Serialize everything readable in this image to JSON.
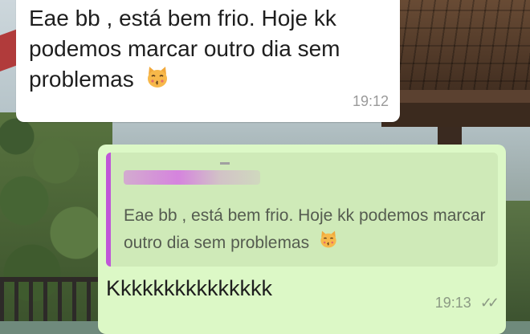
{
  "incoming_message": {
    "text": "Eae bb , está bem frio. Hoje kk podemos marcar outro dia sem problemas",
    "emoji": "cat-kissing-face",
    "time": "19:12"
  },
  "outgoing_message": {
    "quoted": {
      "text": "Eae bb , está bem frio. Hoje kk podemos marcar outro dia sem problemas",
      "emoji": "cat-kissing-face",
      "accent_color": "#c056d8"
    },
    "text": "Kkkkkkkkkkkkkkk",
    "time": "19:13",
    "status": "read-double-check"
  },
  "colors": {
    "incoming_bubble": "#ffffff",
    "outgoing_bubble": "#dcf8c6",
    "quote_background": "#cfeab8"
  }
}
